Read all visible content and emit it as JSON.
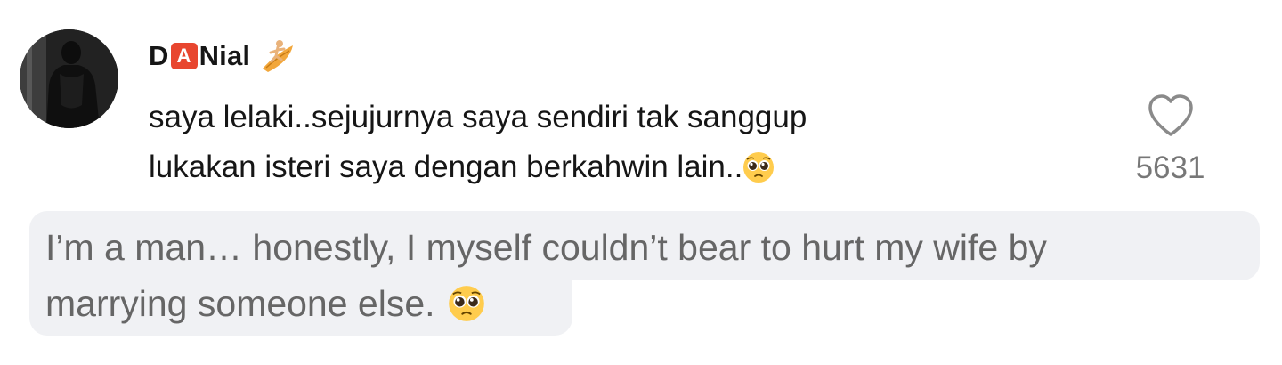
{
  "comment": {
    "username_prefix": "D",
    "username_badge": "A",
    "username_suffix": "Nial",
    "username_emoji": "surfer-icon",
    "text_line1": "saya lelaki..sejujurnya saya sendiri tak sanggup",
    "text_line2": "lukakan isteri saya dengan berkahwin lain..",
    "text_emoji": "pleading-face-icon",
    "like_count": "5631"
  },
  "translation": {
    "line1": "I’m a man… honestly, I myself couldn’t bear to hurt my wife by",
    "line2": "marrying someone else.",
    "emoji": "pleading-face-icon"
  },
  "colors": {
    "badge": "#e8462f",
    "translation_bg": "#f0f1f4",
    "text": "#161616",
    "muted": "#777777"
  }
}
